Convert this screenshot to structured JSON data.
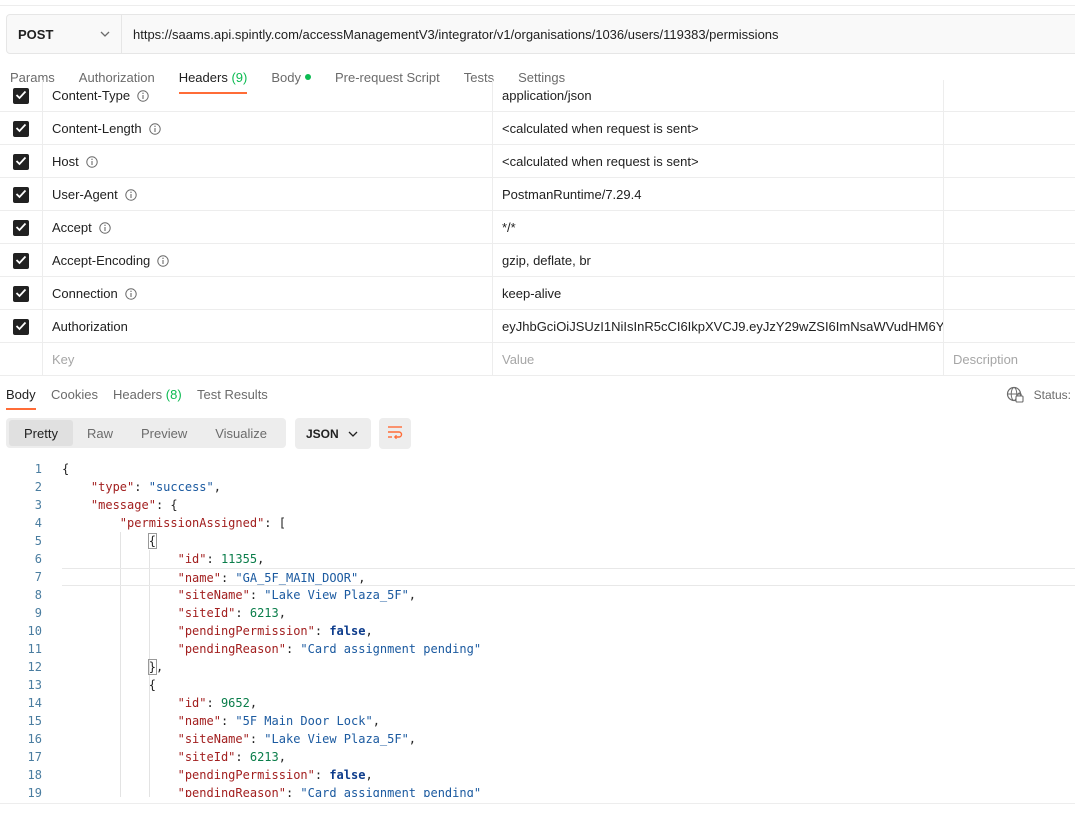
{
  "request": {
    "method": "POST",
    "url": "https://saams.api.spintly.com/accessManagementV3/integrator/v1/organisations/1036/users/119383/permissions"
  },
  "request_tabs": [
    {
      "label": "Params"
    },
    {
      "label": "Authorization"
    },
    {
      "label": "Headers",
      "count": "(9)"
    },
    {
      "label": "Body"
    },
    {
      "label": "Pre-request Script"
    },
    {
      "label": "Tests"
    },
    {
      "label": "Settings"
    }
  ],
  "headers": [
    {
      "key": "Content-Type",
      "value": "application/json",
      "checked": true,
      "info": true
    },
    {
      "key": "Content-Length",
      "value": "<calculated when request is sent>",
      "checked": true,
      "info": true
    },
    {
      "key": "Host",
      "value": "<calculated when request is sent>",
      "checked": true,
      "info": true
    },
    {
      "key": "User-Agent",
      "value": "PostmanRuntime/7.29.4",
      "checked": true,
      "info": true
    },
    {
      "key": "Accept",
      "value": "*/*",
      "checked": true,
      "info": true
    },
    {
      "key": "Accept-Encoding",
      "value": "gzip, deflate, br",
      "checked": true,
      "info": true
    },
    {
      "key": "Connection",
      "value": "keep-alive",
      "checked": true,
      "info": true
    },
    {
      "key": "Authorization",
      "value": "eyJhbGciOiJSUzI1NiIsInR5cCI6IkpXVCJ9.eyJzY29wZSI6ImNsaWVudHM6Y...",
      "checked": true,
      "info": false
    }
  ],
  "headers_placeholder": {
    "key": "Key",
    "value": "Value",
    "description": "Description"
  },
  "response_tabs": [
    {
      "label": "Body"
    },
    {
      "label": "Cookies"
    },
    {
      "label": "Headers",
      "count": "(8)"
    },
    {
      "label": "Test Results"
    }
  ],
  "status_label": "Status:",
  "view_modes": [
    "Pretty",
    "Raw",
    "Preview",
    "Visualize"
  ],
  "format": "JSON",
  "code_lines": [
    "{",
    "    \"type\": \"success\",",
    "    \"message\": {",
    "        \"permissionAssigned\": [",
    "            {",
    "                \"id\": 11355,",
    "                \"name\": \"GA_5F_MAIN_DOOR\",",
    "                \"siteName\": \"Lake View Plaza_5F\",",
    "                \"siteId\": 6213,",
    "                \"pendingPermission\": false,",
    "                \"pendingReason\": \"Card assignment pending\"",
    "            },",
    "            {",
    "                \"id\": 9652,",
    "                \"name\": \"5F Main Door Lock\",",
    "                \"siteName\": \"Lake View Plaza_5F\",",
    "                \"siteId\": 6213,",
    "                \"pendingPermission\": false,",
    "                \"pendingReason\": \"Card assignment pending\""
  ],
  "colors": {
    "accent": "#ff6c37",
    "count_green": "#0cbb52"
  }
}
